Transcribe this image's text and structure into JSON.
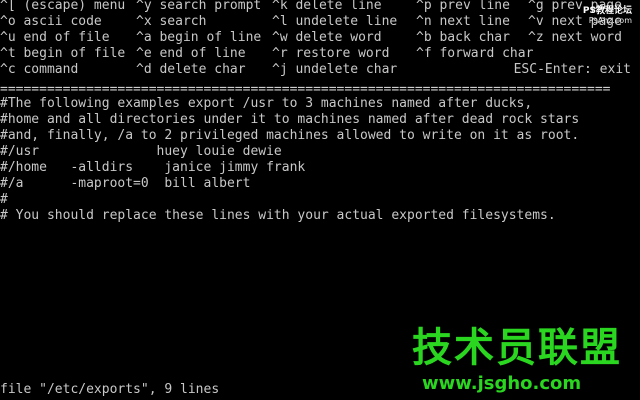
{
  "help": {
    "rows": [
      [
        "^[ (escape) menu",
        "^y search prompt",
        "^k delete line",
        "^p prev line",
        "^g prev page"
      ],
      [
        "^o ascii code",
        "^x search",
        "^l undelete line",
        "^n next line",
        "^v next page"
      ],
      [
        "^u end of file",
        "^a begin of line",
        "^w delete word",
        "^b back char",
        "^z next word"
      ],
      [
        "^t begin of file",
        "^e end of line",
        "^r restore word",
        "^f forward char",
        ""
      ],
      [
        "^c command",
        "^d delete char",
        "^j undelete char",
        "",
        ""
      ]
    ],
    "esc_hint": "ESC-Enter: exit"
  },
  "divider": "==============================================================================",
  "file_lines": [
    "#The following examples export /usr to 3 machines named after ducks,",
    "#home and all directories under it to machines named after dead rock stars",
    "#and, finally, /a to 2 privileged machines allowed to write on it as root.",
    "#/usr               huey louie dewie",
    "#/home   -alldirs    janice jimmy frank",
    "#/a      -maproot=0  bill albert",
    "#",
    "# You should replace these lines with your actual exported filesystems."
  ],
  "status": "file \"/etc/exports\", 9 lines",
  "watermark": {
    "site_cn": "PS教程论坛",
    "site_url": "PsAhz.com",
    "logo_text": "技术员联盟",
    "logo_url": "www.jsgho.com"
  }
}
